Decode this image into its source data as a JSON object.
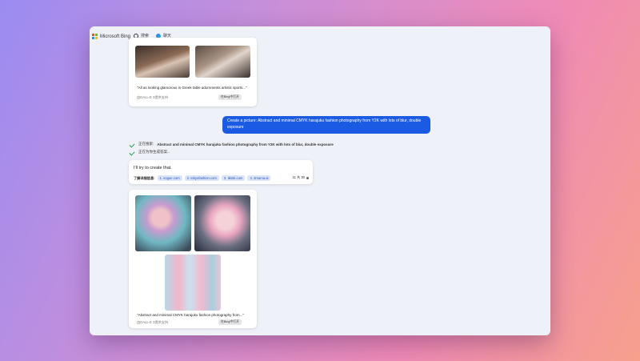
{
  "brand": {
    "name": "Microsoft Bing"
  },
  "nav": {
    "search_label": "搜索",
    "chat_label": "聊天"
  },
  "previous_result": {
    "caption": "\"All as looking glamorous in Greek table adornments artistic sports...\"",
    "subcaption": "由DALL-E 3提供支持",
    "designer_button": "在Bing中打开"
  },
  "user_message": {
    "text": "Create a picture:  Abstract and minimal CMYK harajuku fashion photography from Y2K with lots of blur, double exposure"
  },
  "status": {
    "line1_prefix": "正在搜索:",
    "line1_query": "Abstract and minimal CMYK harajuku fashion photography from Y2K with lots of blur, double exposure",
    "line2": "正在为你生成答案..."
  },
  "reply": {
    "text": "I'll try to create that.",
    "learn_more_label": "了解详细信息:",
    "sources": [
      "1. vogue.com",
      "2. tokyofashion.com",
      "3. tiktok.com",
      "4. 2mama.ai"
    ],
    "counter": "11 共 30"
  },
  "result": {
    "caption": "\"Abstract and minimal CMYK harajuku fashion photography from...\"",
    "subcaption": "由DALL-E 3提供支持",
    "designer_button": "在Bing中打开"
  },
  "colors": {
    "accent": "#1b5be3",
    "check": "#1f9d4f"
  }
}
